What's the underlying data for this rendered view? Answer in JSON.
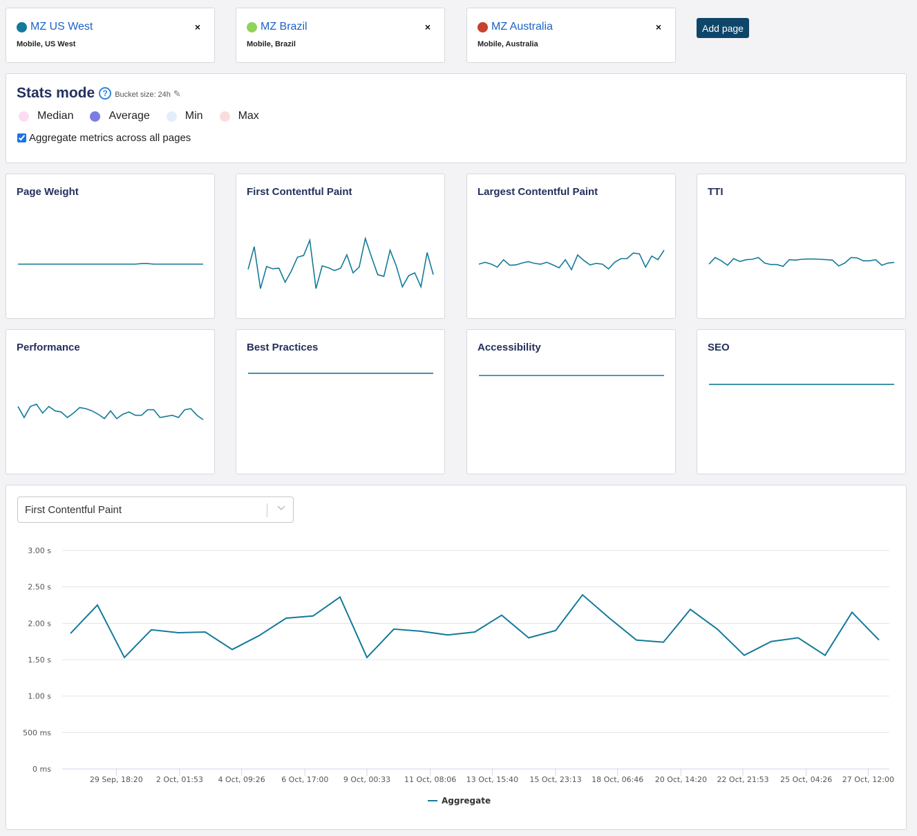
{
  "pages": [
    {
      "name": "MZ US West",
      "subtitle": "Mobile, US West",
      "color": "#137a9a",
      "close": "×"
    },
    {
      "name": "MZ Brazil",
      "subtitle": "Mobile, Brazil",
      "color": "#8fd35a",
      "close": "×"
    },
    {
      "name": "MZ Australia",
      "subtitle": "Mobile, Australia",
      "color": "#c8412b",
      "close": "×"
    }
  ],
  "add_page_label": "Add page",
  "stats": {
    "title": "Stats mode",
    "help": "?",
    "bucket": "Bucket size: 24h",
    "pencil": "✎",
    "modes": [
      {
        "label": "Median",
        "color": "#fbdcf3"
      },
      {
        "label": "Average",
        "color": "#7c7de0"
      },
      {
        "label": "Min",
        "color": "#e2eefb"
      },
      {
        "label": "Max",
        "color": "#fbdcdc"
      }
    ],
    "aggregate_label": "Aggregate metrics across all pages",
    "aggregate_checked": true
  },
  "metrics": [
    {
      "title": "Page Weight",
      "values": [
        0.5,
        0.5,
        0.5,
        0.5,
        0.5,
        0.5,
        0.5,
        0.5,
        0.5,
        0.5,
        0.5,
        0.5,
        0.5,
        0.5,
        0.5,
        0.5,
        0.5,
        0.5,
        0.5,
        0.5,
        0.505,
        0.505,
        0.5,
        0.5,
        0.5,
        0.5,
        0.5,
        0.5,
        0.5,
        0.5,
        0.5
      ]
    },
    {
      "title": "First Contentful Paint",
      "values": [
        1.86,
        2.25,
        1.53,
        1.91,
        1.87,
        1.88,
        1.64,
        1.83,
        2.07,
        2.1,
        2.36,
        1.53,
        1.92,
        1.89,
        1.84,
        1.88,
        2.11,
        1.8,
        1.9,
        2.39,
        2.07,
        1.77,
        1.74,
        2.19,
        1.92,
        1.56,
        1.75,
        1.8,
        1.56,
        2.15,
        1.77
      ]
    },
    {
      "title": "Largest Contentful Paint",
      "values": [
        3.0,
        3.05,
        3.0,
        2.92,
        3.12,
        2.97,
        2.98,
        3.03,
        3.07,
        3.02,
        3.0,
        3.05,
        2.98,
        2.9,
        3.12,
        2.85,
        3.25,
        3.1,
        2.98,
        3.02,
        3.0,
        2.87,
        3.05,
        3.15,
        3.15,
        3.3,
        3.28,
        2.92,
        3.22,
        3.12,
        3.38
      ]
    },
    {
      "title": "TTI",
      "values": [
        5.0,
        5.3,
        5.15,
        4.95,
        5.25,
        5.12,
        5.2,
        5.22,
        5.3,
        5.05,
        4.98,
        4.98,
        4.9,
        5.2,
        5.18,
        5.22,
        5.23,
        5.23,
        5.22,
        5.2,
        5.18,
        4.92,
        5.05,
        5.3,
        5.28,
        5.15,
        5.15,
        5.2,
        4.95,
        5.05,
        5.08
      ]
    },
    {
      "title": "Performance",
      "values": [
        0.62,
        0.52,
        0.62,
        0.64,
        0.56,
        0.62,
        0.58,
        0.57,
        0.52,
        0.56,
        0.61,
        0.6,
        0.58,
        0.55,
        0.51,
        0.58,
        0.51,
        0.55,
        0.57,
        0.54,
        0.54,
        0.59,
        0.59,
        0.52,
        0.53,
        0.54,
        0.52,
        0.59,
        0.6,
        0.54,
        0.5
      ]
    },
    {
      "title": "Best Practices",
      "values": [
        0.92,
        0.92,
        0.92,
        0.92,
        0.92,
        0.92,
        0.92,
        0.92,
        0.92,
        0.92,
        0.92,
        0.92,
        0.92,
        0.92,
        0.92,
        0.92,
        0.92,
        0.92,
        0.92,
        0.92,
        0.92,
        0.92,
        0.92,
        0.92,
        0.92,
        0.92,
        0.92,
        0.92,
        0.92,
        0.92,
        0.92
      ]
    },
    {
      "title": "Accessibility",
      "values": [
        0.9,
        0.9,
        0.9,
        0.9,
        0.9,
        0.9,
        0.9,
        0.9,
        0.9,
        0.9,
        0.9,
        0.9,
        0.9,
        0.9,
        0.9,
        0.9,
        0.9,
        0.9,
        0.9,
        0.9,
        0.9,
        0.9,
        0.9,
        0.9,
        0.9,
        0.9,
        0.9,
        0.9,
        0.9,
        0.9,
        0.9
      ]
    },
    {
      "title": "SEO",
      "values": [
        0.82,
        0.82,
        0.82,
        0.82,
        0.82,
        0.82,
        0.82,
        0.82,
        0.82,
        0.82,
        0.82,
        0.82,
        0.82,
        0.82,
        0.82,
        0.82,
        0.82,
        0.82,
        0.82,
        0.82,
        0.82,
        0.82,
        0.82,
        0.82,
        0.82,
        0.82,
        0.82,
        0.82,
        0.82,
        0.82,
        0.82
      ]
    }
  ],
  "metric_select": {
    "value": "First Contentful Paint",
    "chevron": "⌄"
  },
  "chart_data": {
    "type": "line",
    "title": "First Contentful Paint",
    "xlabel": "",
    "ylabel": "",
    "ylim": [
      0,
      3.0
    ],
    "y_ticks": [
      {
        "value": 0,
        "label": "0 ms"
      },
      {
        "value": 0.5,
        "label": "500 ms"
      },
      {
        "value": 1.0,
        "label": "1.00 s"
      },
      {
        "value": 1.5,
        "label": "1.50 s"
      },
      {
        "value": 2.0,
        "label": "2.00 s"
      },
      {
        "value": 2.5,
        "label": "2.50 s"
      },
      {
        "value": 3.0,
        "label": "3.00 s"
      }
    ],
    "x_ticks": [
      {
        "index": 1.7,
        "label": "29 Sep, 18:20"
      },
      {
        "index": 4.05,
        "label": "2 Oct, 01:53"
      },
      {
        "index": 6.35,
        "label": "4 Oct, 09:26"
      },
      {
        "index": 8.7,
        "label": "6 Oct, 17:00"
      },
      {
        "index": 11.0,
        "label": "9 Oct, 00:33"
      },
      {
        "index": 13.35,
        "label": "11 Oct, 08:06"
      },
      {
        "index": 15.65,
        "label": "13 Oct, 15:40"
      },
      {
        "index": 18.0,
        "label": "15 Oct, 23:13"
      },
      {
        "index": 20.3,
        "label": "18 Oct, 06:46"
      },
      {
        "index": 22.65,
        "label": "20 Oct, 14:20"
      },
      {
        "index": 24.95,
        "label": "22 Oct, 21:53"
      },
      {
        "index": 27.3,
        "label": "25 Oct, 04:26"
      },
      {
        "index": 29.6,
        "label": "27 Oct, 12:00"
      }
    ],
    "grid": true,
    "legend_position": "bottom-center",
    "series": [
      {
        "name": "Aggregate",
        "color": "#137a9a",
        "values": [
          1.86,
          2.25,
          1.53,
          1.91,
          1.87,
          1.88,
          1.64,
          1.83,
          2.07,
          2.1,
          2.36,
          1.53,
          1.92,
          1.89,
          1.84,
          1.88,
          2.11,
          1.8,
          1.9,
          2.39,
          2.07,
          1.77,
          1.74,
          2.19,
          1.92,
          1.56,
          1.75,
          1.8,
          1.56,
          2.15,
          1.77
        ]
      }
    ]
  }
}
